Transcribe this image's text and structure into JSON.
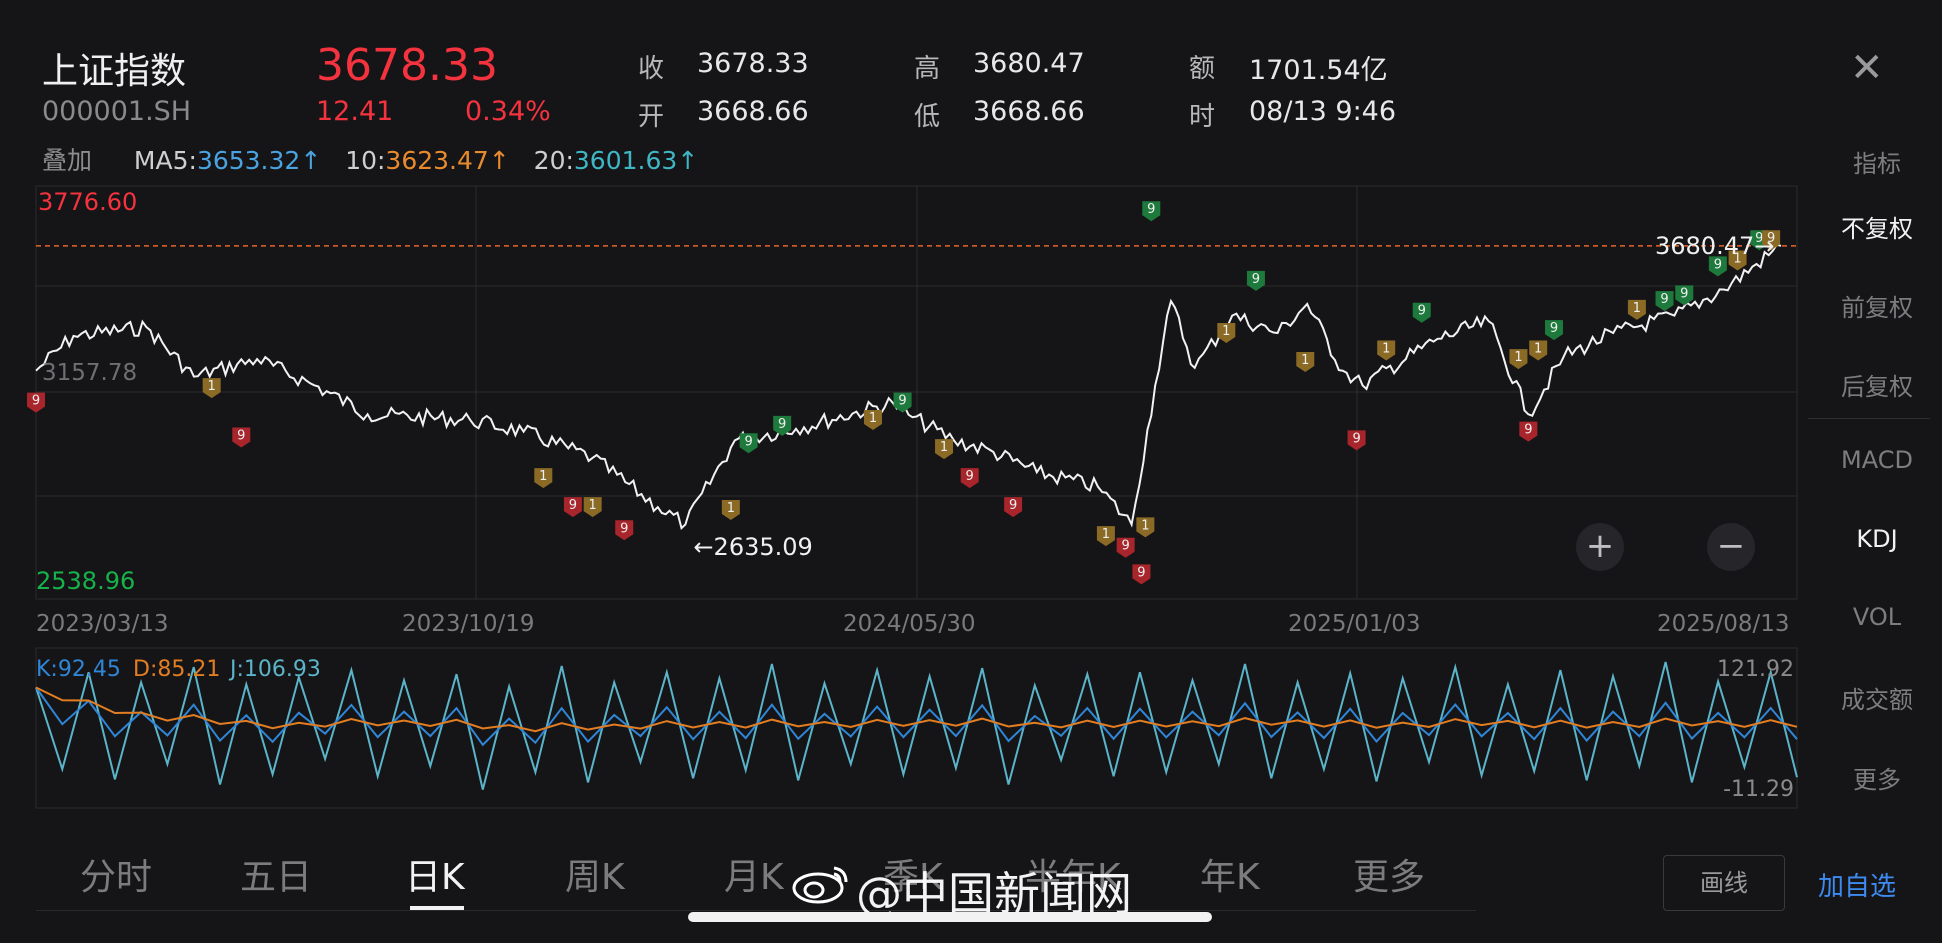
{
  "header": {
    "name": "上证指数",
    "code": "000001.SH",
    "price": "3678.33",
    "change": "12.41",
    "change_pct": "0.34%",
    "quotes": [
      {
        "label": "收",
        "value": "3678.33"
      },
      {
        "label": "开",
        "value": "3668.66"
      },
      {
        "label": "高",
        "value": "3680.47"
      },
      {
        "label": "低",
        "value": "3668.66"
      },
      {
        "label": "额",
        "value": "1701.54亿"
      },
      {
        "label": "时",
        "value": "08/13 9:46"
      }
    ],
    "close_icon": "close-icon"
  },
  "ma": {
    "overlay_label": "叠加",
    "ma5_label": "MA5:",
    "ma5": "3653.32↑",
    "ma10_label": "10:",
    "ma10": "3623.47↑",
    "ma20_label": "20:",
    "ma20": "3601.63↑",
    "colors": {
      "ma5": "#4aa3e0",
      "ma10": "#e88b2e",
      "ma20": "#3fb6c4"
    }
  },
  "side_menu": [
    "指标",
    "不复权",
    "前复权",
    "后复权",
    "MACD",
    "KDJ",
    "VOL",
    "成交额",
    "更多"
  ],
  "side_active": [
    "不复权",
    "KDJ"
  ],
  "tabs": [
    "分时",
    "五日",
    "日K",
    "周K",
    "月K",
    "季K",
    "半年K",
    "年K",
    "更多"
  ],
  "active_tab": "日K",
  "buttons": {
    "draw": "画线",
    "add_watch": "加自选"
  },
  "watermark": "@中国新闻网",
  "colors": {
    "up": "#f5333f",
    "down": "#16b34a",
    "line": "#f2f2f2",
    "badge_red": "#a8252b",
    "badge_green": "#1e7a3c",
    "badge_gold": "#8a6a25"
  },
  "chart_data": [
    {
      "type": "line",
      "name": "price",
      "ymax_label": "3776.60",
      "ymin_label": "2538.96",
      "mid_label": "3157.78",
      "ylim": [
        2538.96,
        3776.6
      ],
      "x_labels": [
        "2023/03/13",
        "2023/10/19",
        "2024/05/30",
        "2025/01/03",
        "2025/08/13"
      ],
      "x": [
        "2023/03/13",
        "2023/04/01",
        "2023/05/08",
        "2023/06/01",
        "2023/07/03",
        "2023/08/01",
        "2023/08/28",
        "2023/10/19",
        "2023/11/15",
        "2023/12/20",
        "2024/01/22",
        "2024/02/05",
        "2024/03/01",
        "2024/04/01",
        "2024/05/20",
        "2024/05/30",
        "2024/06/20",
        "2024/07/10",
        "2024/08/01",
        "2024/09/01",
        "2024/09/18",
        "2024/09/30",
        "2024/10/08",
        "2024/10/20",
        "2024/11/08",
        "2024/12/01",
        "2024/12/16",
        "2025/01/03",
        "2025/01/13",
        "2025/02/20",
        "2025/03/18",
        "2025/04/07",
        "2025/04/25",
        "2025/05/20",
        "2025/06/20",
        "2025/07/15",
        "2025/08/13"
      ],
      "values": [
        3250,
        3370,
        3400,
        3230,
        3290,
        3200,
        3100,
        3080,
        3040,
        2950,
        2780,
        2720,
        3010,
        3050,
        3140,
        3090,
        3010,
        2970,
        2900,
        2850,
        2720,
        3200,
        3490,
        3260,
        3440,
        3380,
        3480,
        3250,
        3200,
        3360,
        3420,
        3100,
        3300,
        3380,
        3440,
        3530,
        3680.47
      ],
      "annotations": [
        {
          "text": "←2635.09",
          "x": "2024/02/05",
          "value": 2635.09
        },
        {
          "text": "3680.47→",
          "x": "2025/08/13",
          "value": 3680.47
        }
      ],
      "markers": [
        {
          "x": "2023/03/13",
          "value": 3140,
          "label": "9",
          "kind": "red"
        },
        {
          "x": "2023/06/10",
          "value": 3190,
          "label": "1",
          "kind": "gold"
        },
        {
          "x": "2023/06/25",
          "value": 3020,
          "label": "9",
          "kind": "red"
        },
        {
          "x": "2023/11/25",
          "value": 2880,
          "label": "1",
          "kind": "gold"
        },
        {
          "x": "2023/12/10",
          "value": 2780,
          "label": "9",
          "kind": "red"
        },
        {
          "x": "2023/12/20",
          "value": 2780,
          "label": "1",
          "kind": "gold"
        },
        {
          "x": "2024/01/05",
          "value": 2700,
          "label": "9",
          "kind": "red"
        },
        {
          "x": "2024/02/28",
          "value": 2770,
          "label": "1",
          "kind": "gold"
        },
        {
          "x": "2024/03/08",
          "value": 3000,
          "label": "9",
          "kind": "green"
        },
        {
          "x": "2024/03/25",
          "value": 3060,
          "label": "9",
          "kind": "green"
        },
        {
          "x": "2024/05/10",
          "value": 3080,
          "label": "1",
          "kind": "gold"
        },
        {
          "x": "2024/05/25",
          "value": 3140,
          "label": "9",
          "kind": "green"
        },
        {
          "x": "2024/06/15",
          "value": 2980,
          "label": "1",
          "kind": "gold"
        },
        {
          "x": "2024/06/28",
          "value": 2880,
          "label": "9",
          "kind": "red"
        },
        {
          "x": "2024/07/20",
          "value": 2780,
          "label": "9",
          "kind": "red"
        },
        {
          "x": "2024/09/05",
          "value": 2680,
          "label": "1",
          "kind": "gold"
        },
        {
          "x": "2024/09/15",
          "value": 2640,
          "label": "9",
          "kind": "red"
        },
        {
          "x": "2024/09/25",
          "value": 2710,
          "label": "1",
          "kind": "gold"
        },
        {
          "x": "2024/09/23",
          "value": 2548,
          "label": "9",
          "kind": "red"
        },
        {
          "x": "2024/09/28",
          "value": 3800,
          "label": "9",
          "kind": "green"
        },
        {
          "x": "2024/11/20",
          "value": 3560,
          "label": "9",
          "kind": "green"
        },
        {
          "x": "2024/11/05",
          "value": 3380,
          "label": "1",
          "kind": "gold"
        },
        {
          "x": "2024/12/15",
          "value": 3280,
          "label": "1",
          "kind": "gold"
        },
        {
          "x": "2025/01/10",
          "value": 3010,
          "label": "9",
          "kind": "red"
        },
        {
          "x": "2025/01/25",
          "value": 3320,
          "label": "1",
          "kind": "gold"
        },
        {
          "x": "2025/02/12",
          "value": 3450,
          "label": "9",
          "kind": "green"
        },
        {
          "x": "2025/04/02",
          "value": 3290,
          "label": "1",
          "kind": "gold"
        },
        {
          "x": "2025/04/07",
          "value": 3040,
          "label": "9",
          "kind": "red"
        },
        {
          "x": "2025/04/12",
          "value": 3320,
          "label": "1",
          "kind": "gold"
        },
        {
          "x": "2025/04/20",
          "value": 3390,
          "label": "9",
          "kind": "green"
        },
        {
          "x": "2025/06/01",
          "value": 3460,
          "label": "1",
          "kind": "gold"
        },
        {
          "x": "2025/06/15",
          "value": 3490,
          "label": "9",
          "kind": "green"
        },
        {
          "x": "2025/06/25",
          "value": 3510,
          "label": "9",
          "kind": "green"
        },
        {
          "x": "2025/07/12",
          "value": 3610,
          "label": "9",
          "kind": "green"
        },
        {
          "x": "2025/07/22",
          "value": 3630,
          "label": "1",
          "kind": "gold"
        },
        {
          "x": "2025/08/02",
          "value": 3700,
          "label": "9",
          "kind": "green"
        },
        {
          "x": "2025/08/08",
          "value": 3700,
          "label": "9",
          "kind": "gold"
        }
      ],
      "ref_line": 3680.47
    },
    {
      "type": "line",
      "name": "KDJ",
      "labels": {
        "k": "K:92.45",
        "d": "D:85.21",
        "j": "J:106.93"
      },
      "ymax_label": "121.92",
      "ymin_label": "-11.29",
      "ylim": [
        -11.29,
        121.92
      ],
      "colors": {
        "k": "#2f86d6",
        "d": "#e27d22",
        "j": "#5bb4c9"
      },
      "cycles": [
        13,
        12,
        12,
        14,
        11,
        13,
        12,
        12,
        13,
        14,
        12,
        11,
        13,
        12,
        14,
        12,
        13,
        12,
        11,
        13,
        12,
        12,
        14,
        13,
        12,
        11,
        13,
        12,
        13,
        12,
        12,
        14,
        11,
        13
      ],
      "j": [
        95,
        15,
        110,
        5,
        100,
        20,
        115,
        0,
        98,
        10,
        105,
        25,
        112,
        8,
        102,
        18,
        108,
        -5,
        96,
        12,
        116,
        2,
        100,
        22,
        110,
        6,
        104,
        14,
        118,
        4,
        99,
        20,
        112,
        10,
        106,
        16,
        114,
        0,
        97,
        24,
        108,
        8,
        110,
        12,
        102,
        20,
        118,
        6,
        100,
        15,
        109,
        3,
        104,
        22,
        115,
        9,
        98,
        13,
        112,
        4,
        106,
        18,
        120,
        2,
        101,
        17,
        110,
        7
      ]
    }
  ]
}
